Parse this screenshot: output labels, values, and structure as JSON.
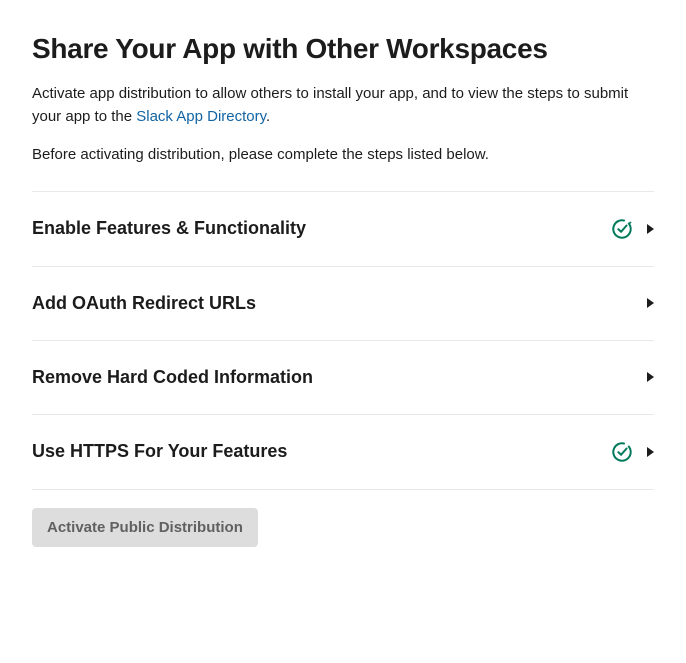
{
  "header": {
    "title": "Share Your App with Other Workspaces",
    "intro_prefix": "Activate app distribution to allow others to install your app, and to view the steps to submit your app to the ",
    "intro_link_text": "Slack App Directory",
    "intro_suffix": ".",
    "sub_text": "Before activating distribution, please complete the steps listed below."
  },
  "steps": [
    {
      "title": "Enable Features & Functionality",
      "completed": true
    },
    {
      "title": "Add OAuth Redirect URLs",
      "completed": false
    },
    {
      "title": "Remove Hard Coded Information",
      "completed": false
    },
    {
      "title": "Use HTTPS For Your Features",
      "completed": true
    }
  ],
  "activate_button_label": "Activate Public Distribution",
  "colors": {
    "success": "#007a5a",
    "link": "#1264a3"
  }
}
